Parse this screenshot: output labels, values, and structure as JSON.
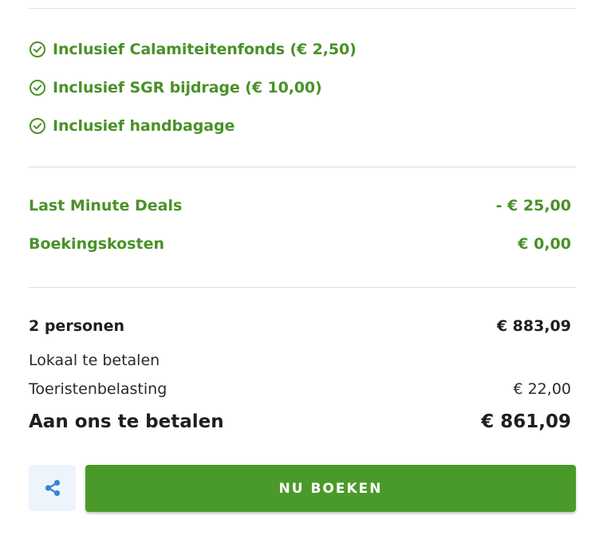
{
  "colors": {
    "accent_green": "#4a9128",
    "button_green": "#4a9a2a",
    "share_bg": "#eef4fb",
    "share_icon": "#3a84d4",
    "text_dark": "#1f1f1f"
  },
  "inclusions": [
    {
      "icon": "check-circle-icon",
      "label": "Inclusief Calamiteitenfonds (€ 2,50)"
    },
    {
      "icon": "check-circle-icon",
      "label": "Inclusief SGR bijdrage (€ 10,00)"
    },
    {
      "icon": "check-circle-icon",
      "label": "Inclusief handbagage"
    }
  ],
  "discounts": {
    "last_minute": {
      "label": "Last Minute Deals",
      "value": "- € 25,00"
    },
    "booking_costs": {
      "label": "Boekingskosten",
      "value": "€ 0,00"
    }
  },
  "summary": {
    "persons": {
      "label": "2 personen",
      "value": "€ 883,09"
    },
    "local_pay": {
      "label": "Lokaal te betalen"
    },
    "tourist_tax": {
      "label": "Toeristenbelasting",
      "value": "€ 22,00"
    },
    "total": {
      "label": "Aan ons te betalen",
      "value": "€ 861,09"
    }
  },
  "actions": {
    "share_icon": "share-icon",
    "book_label": "NU BOEKEN"
  }
}
